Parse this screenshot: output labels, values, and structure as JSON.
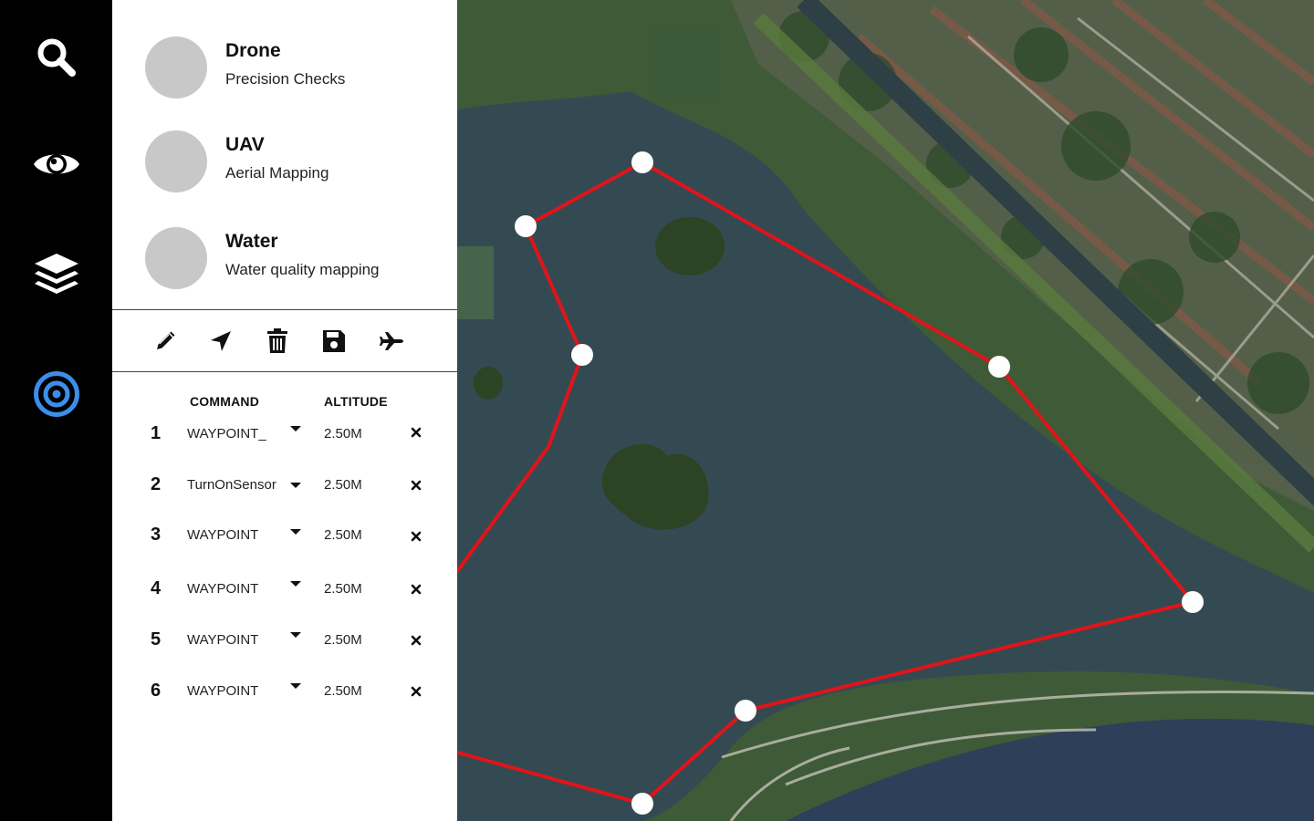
{
  "sidebar": {
    "items": [
      {
        "icon": "search-icon"
      },
      {
        "icon": "eye-icon"
      },
      {
        "icon": "layers-icon"
      },
      {
        "icon": "target-icon",
        "active": true
      }
    ],
    "active_color": "#3d8eeb"
  },
  "profiles": [
    {
      "name": "Drone",
      "subtitle": "Precision Checks"
    },
    {
      "name": "UAV",
      "subtitle": "Aerial Mapping"
    },
    {
      "name": "Water",
      "subtitle": "Water quality mapping"
    }
  ],
  "toolbar": {
    "tools": [
      "pencil-icon",
      "navigate-icon",
      "trash-icon",
      "save-icon",
      "airplane-icon"
    ]
  },
  "mission_table": {
    "headers": {
      "command": "COMMAND",
      "altitude": "ALTITUDE"
    },
    "rows": [
      {
        "num": "1",
        "command": "WAYPOINT_",
        "altitude": "2.50M"
      },
      {
        "num": "2",
        "command": "TurnOnSensor",
        "altitude": "2.50M"
      },
      {
        "num": "3",
        "command": "WAYPOINT",
        "altitude": "2.50M"
      },
      {
        "num": "4",
        "command": "WAYPOINT",
        "altitude": "2.50M"
      },
      {
        "num": "5",
        "command": "WAYPOINT",
        "altitude": "2.50M"
      },
      {
        "num": "6",
        "command": "WAYPOINT",
        "altitude": "2.50M"
      }
    ]
  },
  "map": {
    "type": "satellite",
    "route_color": "#e0141a",
    "water_color": "#344a52",
    "land_color": "#3f5a37"
  }
}
